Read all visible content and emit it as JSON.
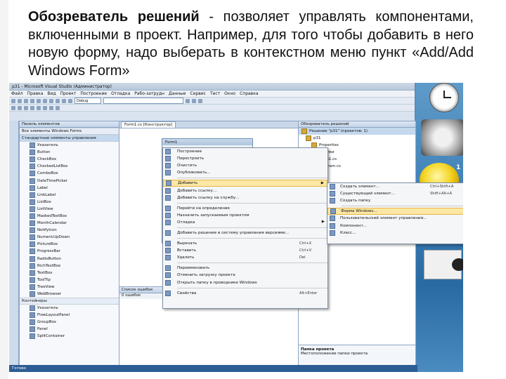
{
  "slide": {
    "heading_bold": "Обозреватель решений",
    "heading_rest": " - позволяет управлять компонентами, включенными в проект. Например, для того чтобы добавить в него новую форму, надо выберать в контекстном меню пункт «Add/Add Windows Form»"
  },
  "vs": {
    "window_title": "p31 - Microsoft Visual Studio (Администратор)",
    "menu": [
      "Файл",
      "Правка",
      "Вид",
      "Проект",
      "Построение",
      "Отладка",
      "Рабо-затрудн",
      "Данные",
      "Сервис",
      "Тест",
      "Окно",
      "Справка"
    ],
    "config_dropdown": "Debug",
    "toolbox_title": "Панель элементов",
    "toolbox_group_all": "Все элементы Windows Forms",
    "toolbox_group_common": "Стандартные элементы управления",
    "toolbox_items": [
      "Указатель",
      "Button",
      "CheckBox",
      "CheckedListBox",
      "ComboBox",
      "DateTimePicker",
      "Label",
      "LinkLabel",
      "ListBox",
      "ListView",
      "MaskedTextBox",
      "MonthCalendar",
      "NotifyIcon",
      "NumericUpDown",
      "PictureBox",
      "ProgressBar",
      "RadioButton",
      "RichTextBox",
      "TextBox",
      "ToolTip",
      "TreeView",
      "WebBrowser"
    ],
    "toolbox_group_containers": "Контейнеры",
    "container_items": [
      "Указатель",
      "FlowLayoutPanel",
      "GroupBox",
      "Panel",
      "SplitContainer"
    ],
    "designer_tab": "Form1.cs [Конструктор]",
    "form_title": "Form1",
    "errors_title": "Список ошибок",
    "errors_filter": "0 ошибок",
    "solution_title": "Обозреватель решений",
    "solution_items": [
      "Решение \"p31\" (проектов: 1)",
      "p31",
      "Properties",
      "Ссылки",
      "Form1.cs",
      "Program.cs"
    ],
    "props_title": "Папка проекта",
    "props_desc": "Местоположение папки проекта",
    "status": "Готово"
  },
  "context_menu": [
    {
      "label": "Построение",
      "shortcut": "",
      "arrow": false
    },
    {
      "label": "Перестроить",
      "shortcut": "",
      "arrow": false
    },
    {
      "label": "Очистить",
      "shortcut": "",
      "arrow": false
    },
    {
      "label": "Опубликовать...",
      "shortcut": "",
      "arrow": false
    },
    {
      "label": "Добавить",
      "shortcut": "",
      "arrow": true,
      "highlight": true
    },
    {
      "label": "Добавить ссылку...",
      "shortcut": "",
      "arrow": false
    },
    {
      "label": "Добавить ссылку на службу...",
      "shortcut": "",
      "arrow": false
    },
    {
      "label": "Перейти на определение",
      "shortcut": "",
      "arrow": false
    },
    {
      "label": "Назначить запускаемым проектом",
      "shortcut": "",
      "arrow": false
    },
    {
      "label": "Отладка",
      "shortcut": "",
      "arrow": true
    },
    {
      "label": "Добавить решение в систему управления версиями...",
      "shortcut": "",
      "arrow": false
    },
    {
      "label": "Вырезать",
      "shortcut": "Ctrl+X",
      "arrow": false
    },
    {
      "label": "Вставить",
      "shortcut": "Ctrl+V",
      "arrow": false
    },
    {
      "label": "Удалить",
      "shortcut": "Del",
      "arrow": false
    },
    {
      "label": "Переименовать",
      "shortcut": "",
      "arrow": false
    },
    {
      "label": "Отменить загрузку проекта",
      "shortcut": "",
      "arrow": false
    },
    {
      "label": "Открыть папку в проводнике Windows",
      "shortcut": "",
      "arrow": false
    },
    {
      "label": "Свойства",
      "shortcut": "Alt+Enter",
      "arrow": false
    }
  ],
  "submenu": [
    {
      "label": "Создать элемент...",
      "shortcut": "Ctrl+Shift+A"
    },
    {
      "label": "Существующий элемент...",
      "shortcut": "Shift+Alt+A"
    },
    {
      "label": "Создать папку",
      "shortcut": ""
    },
    {
      "label": "Форма Windows...",
      "shortcut": "",
      "highlight": true
    },
    {
      "label": "Пользовательский элемент управления...",
      "shortcut": ""
    },
    {
      "label": "Компонент...",
      "shortcut": ""
    },
    {
      "label": "Класс...",
      "shortcut": ""
    }
  ],
  "gadgets": {
    "weather_num": "1"
  },
  "colors": {
    "menu_highlight": "#fce7a4",
    "statusbar": "#2c5d94",
    "desktop": "#3d7fb6"
  }
}
